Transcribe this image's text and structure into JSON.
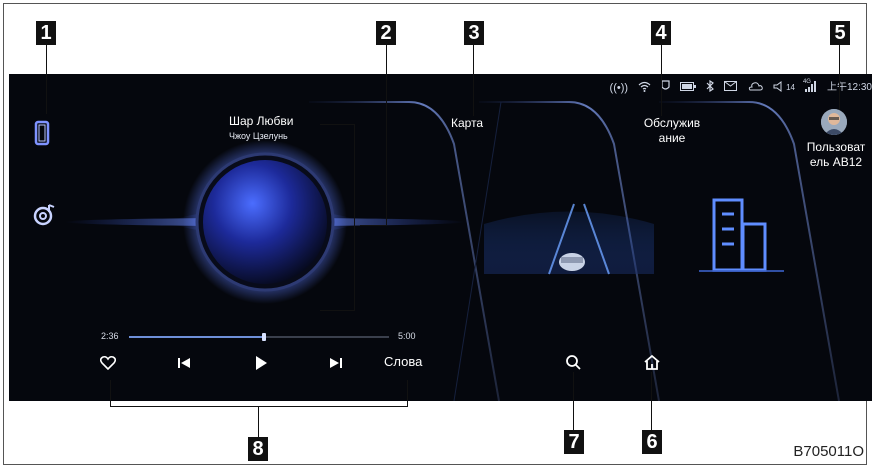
{
  "callouts": [
    "1",
    "2",
    "3",
    "4",
    "5",
    "6",
    "7",
    "8"
  ],
  "figure_code": "B705011O",
  "status_bar": {
    "temperature": "14",
    "signal_label": "4G",
    "time": "上午12:30"
  },
  "music": {
    "title": "Шар Любви",
    "artist": "Чжоу Цзелунь",
    "elapsed": "2:36",
    "duration": "5:00",
    "progress": 0.52,
    "lyrics_label": "Слова"
  },
  "cards": {
    "map_label": "Карта",
    "service_label": "Обслужив\nание"
  },
  "user": {
    "name": "Пользоват\nель AB12"
  },
  "icons": {
    "nav_phone": "phone-icon",
    "nav_music": "music-icon",
    "heart": "heart-icon",
    "prev": "previous-icon",
    "play": "play-icon",
    "next": "next-icon",
    "search": "search-icon",
    "home": "home-icon"
  }
}
